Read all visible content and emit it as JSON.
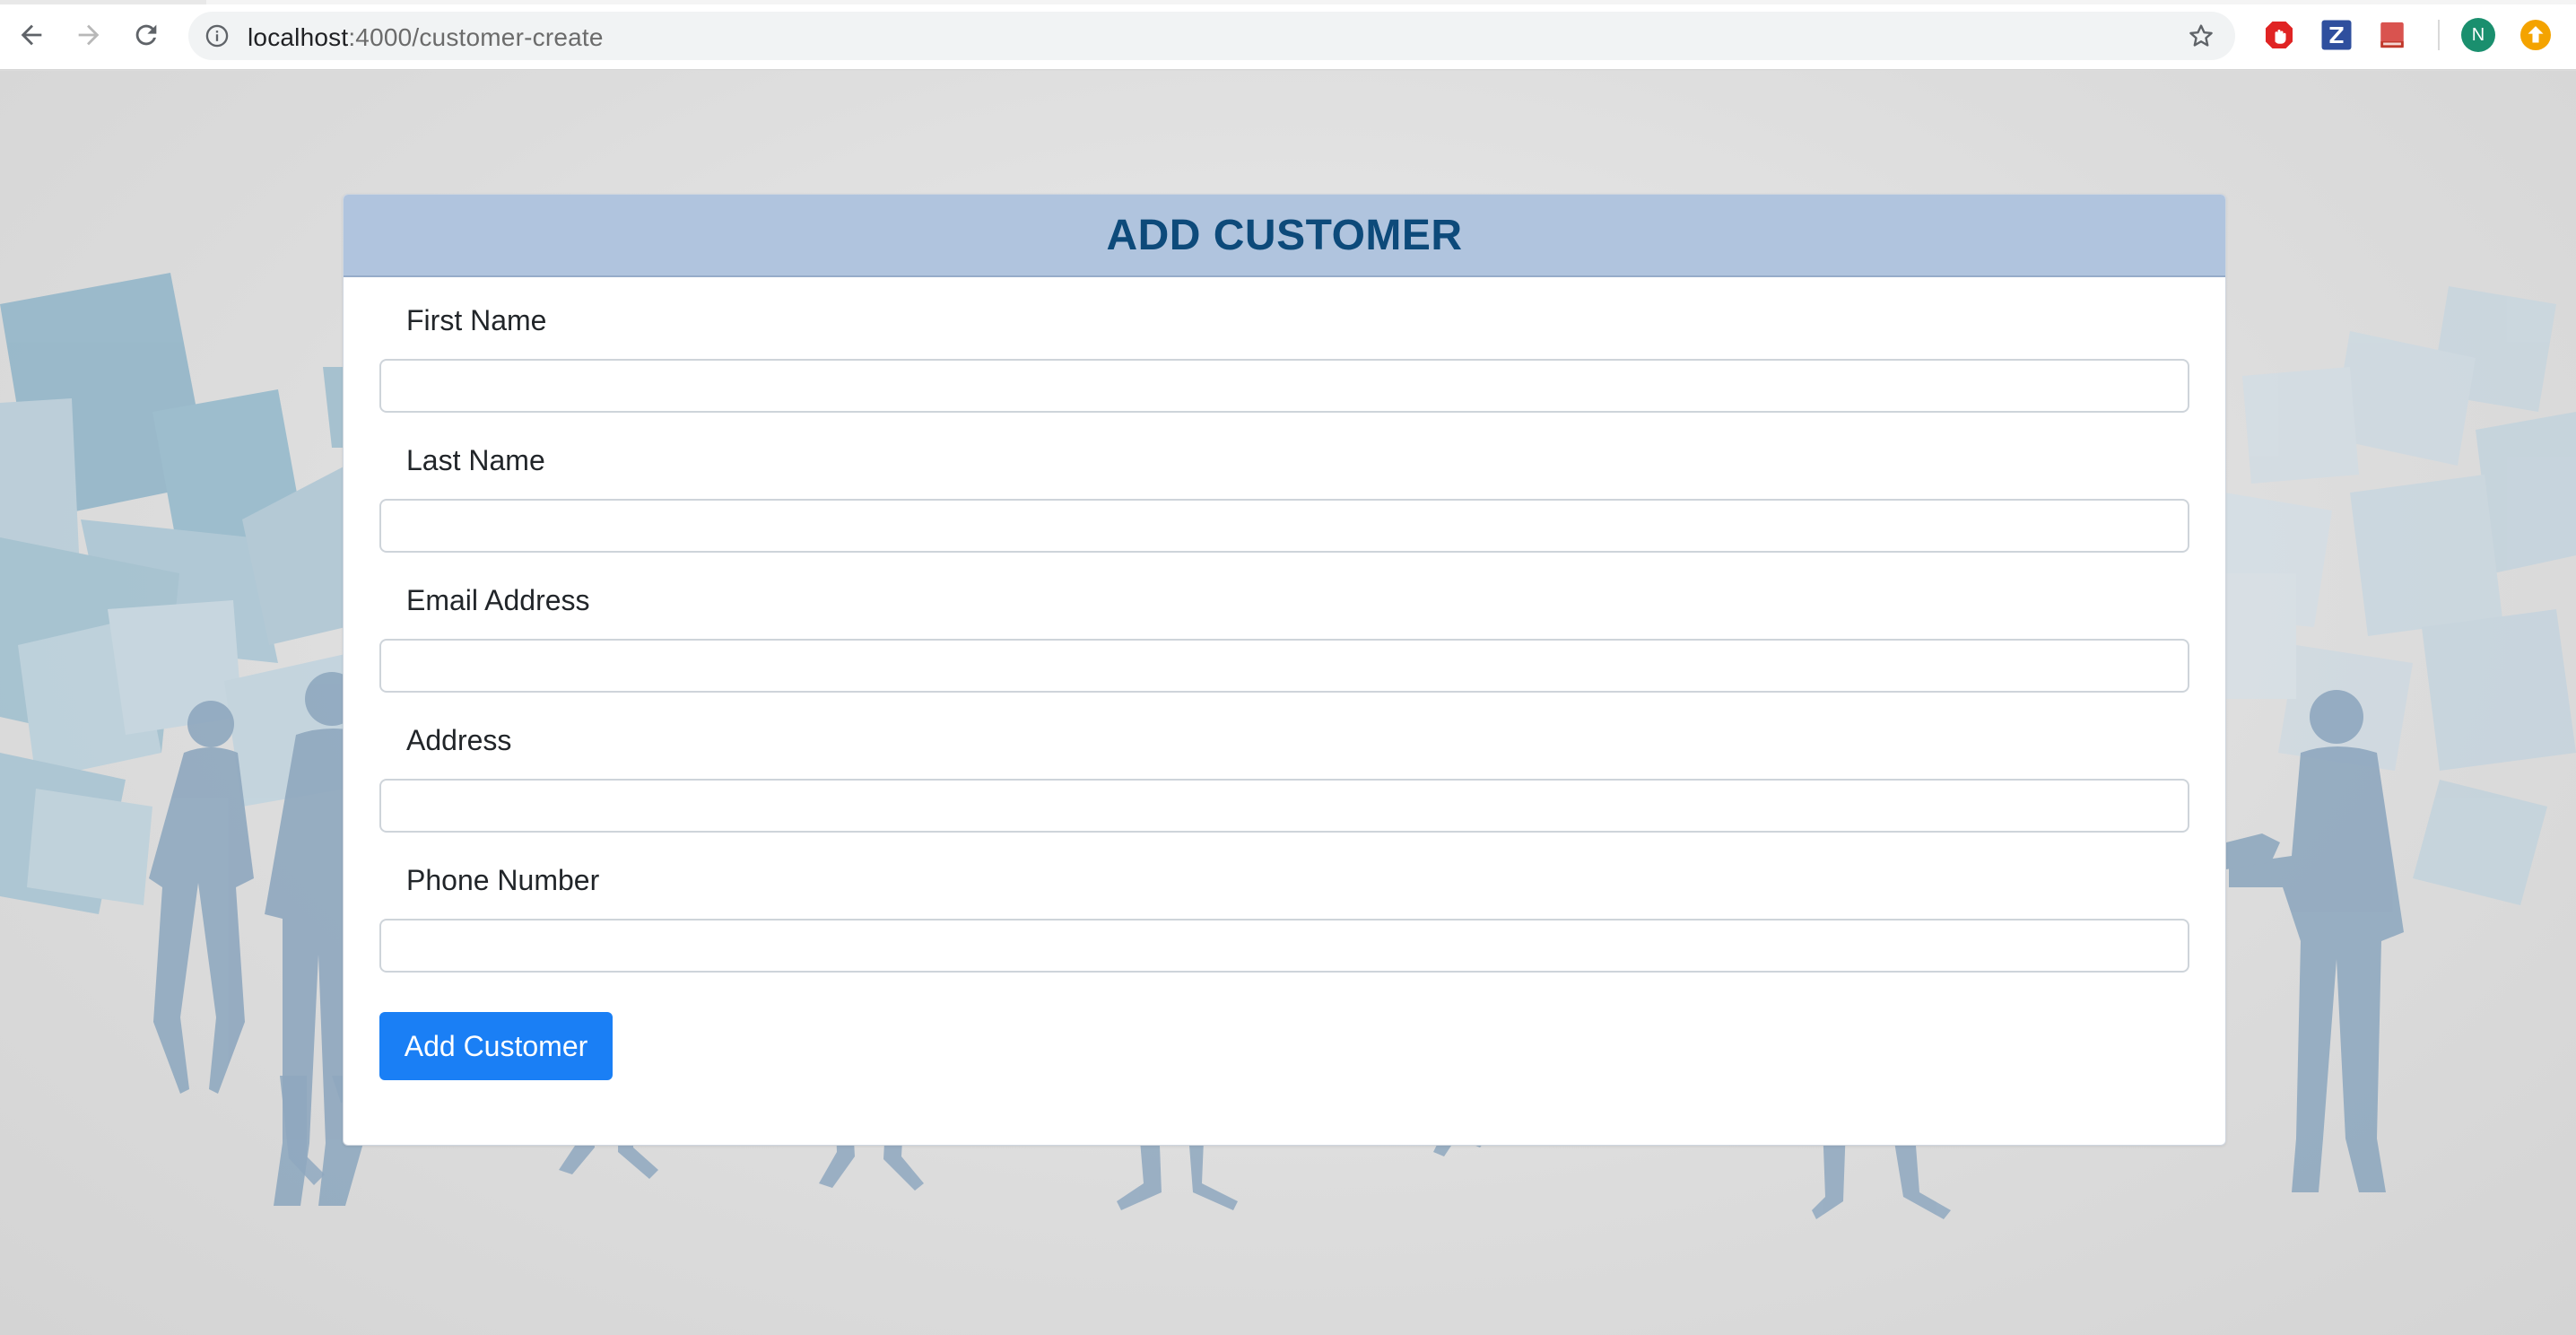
{
  "browser": {
    "url_host": "localhost",
    "url_path": ":4000/customer-create",
    "profile_initial": "N",
    "colors": {
      "ext_red": "#e02424",
      "ext_z_bg": "#2f4f9e",
      "ext_book": "#d9534f",
      "profile_bg": "#1a8f6e",
      "ext_orange": "#f4a300"
    }
  },
  "page": {
    "title": "ADD CUSTOMER",
    "fields": [
      {
        "label": "First Name",
        "value": "",
        "placeholder": ""
      },
      {
        "label": "Last Name",
        "value": "",
        "placeholder": ""
      },
      {
        "label": "Email Address",
        "value": "",
        "placeholder": ""
      },
      {
        "label": "Address",
        "value": "",
        "placeholder": ""
      },
      {
        "label": "Phone Number",
        "value": "",
        "placeholder": ""
      }
    ],
    "submit_label": "Add Customer",
    "colors": {
      "header_bg": "#b0c4de",
      "title_color": "#0d4a7a",
      "button_bg": "#1a7ff5"
    }
  },
  "icons": {
    "back": "arrow-left-icon",
    "forward": "arrow-right-icon",
    "reload": "reload-icon",
    "info": "info-circle-icon",
    "bookmark": "star-outline-icon",
    "ext1": "hand-stop-icon",
    "ext2": "z-letter-icon",
    "ext3": "book-icon",
    "ext4": "profile-avatar-icon",
    "ext5": "upload-arrow-icon"
  }
}
